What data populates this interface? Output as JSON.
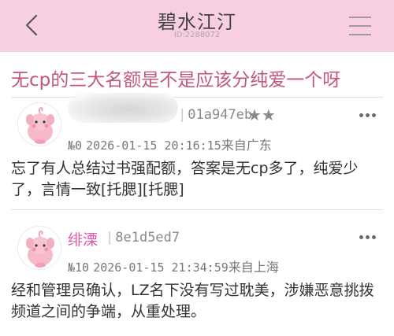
{
  "header": {
    "title": "碧水江汀",
    "id_text": "ID:2288072"
  },
  "thread": {
    "title": "无cp的三大名额是不是应该分纯爱一个呀"
  },
  "posts": [
    {
      "user_hash": "01a947eb",
      "stars": "★★",
      "floor": "№0",
      "datetime": "2026-01-15 20:16:15",
      "location": "来自广东",
      "body": "忘了有人总结过书强配额，答案是无cp多了，纯爱少了，言情一致[托腮][托腮]"
    },
    {
      "username": "绯溧",
      "user_hash": "8e1d5ed7",
      "floor": "№10",
      "datetime": "2026-01-15 21:34:59",
      "location": "来自上海",
      "body": "经和管理员确认，LZ名下没有写过耽美，涉嫌恶意挑拨频道之间的争端，从重处理。"
    }
  ],
  "icons": {
    "back": "chevron-left-icon",
    "menu": "hamburger-menu-icon",
    "more": "more-horizontal-icon",
    "avatar": "pink-creature-avatar"
  },
  "colors": {
    "header_bg": "#f8cfe1",
    "title_pink": "#c2567e",
    "username_pink": "#e05aa8"
  }
}
